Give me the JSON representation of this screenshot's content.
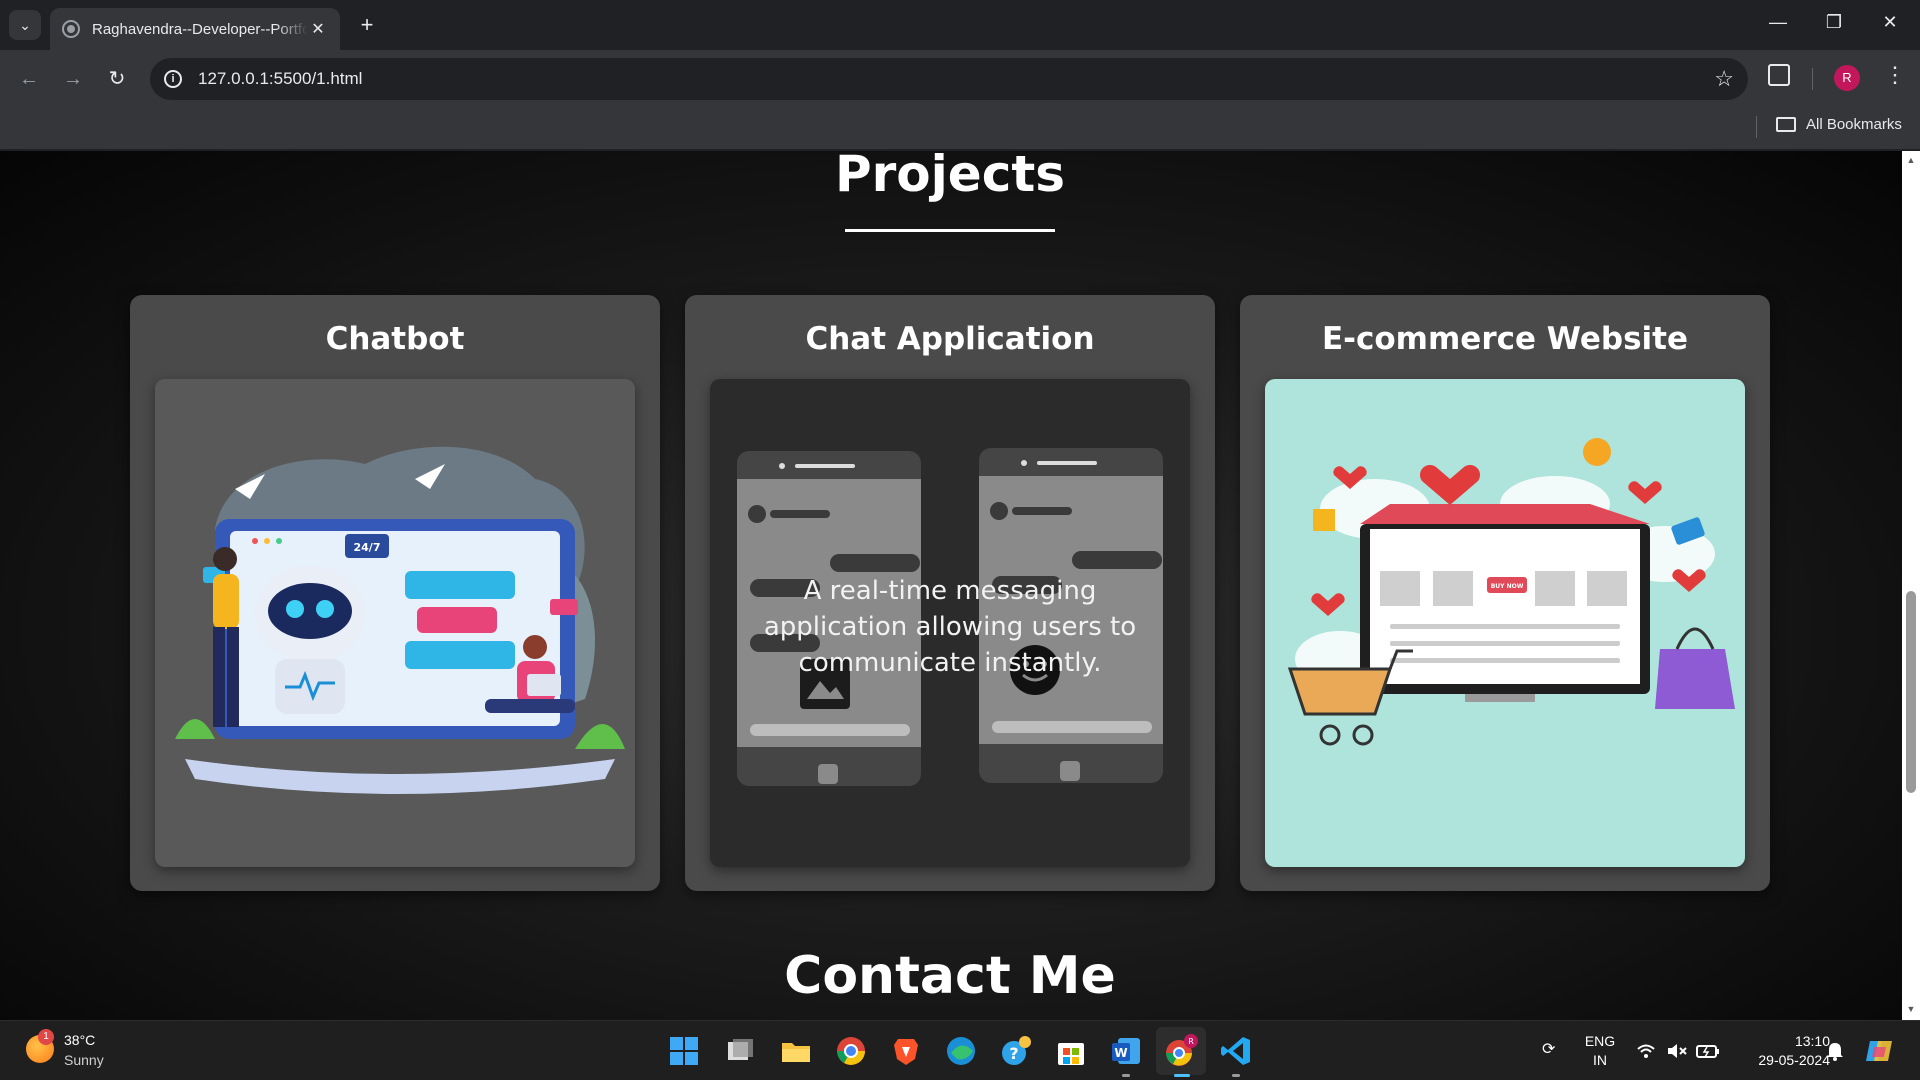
{
  "browser": {
    "tab_title": "Raghavendra--Developer--Portfolio",
    "tab_close": "✕",
    "new_tab": "+",
    "url": "127.0.0.1:5500/1.html",
    "bookmarks_label": "All Bookmarks",
    "profile_initial": "R",
    "minimize": "—",
    "restore": "❐",
    "close": "✕"
  },
  "page": {
    "projects_title": "Projects",
    "contact_title": "Contact Me",
    "cards": [
      {
        "title": "Chatbot"
      },
      {
        "title": "Chat Application",
        "description": "A real-time messaging application allowing users to communicate instantly."
      },
      {
        "title": "E-commerce Website"
      }
    ],
    "illustrations": {
      "chatbot_badge": "24/7",
      "ecommerce_button": "BUY NOW"
    }
  },
  "taskbar": {
    "weather_temp": "38°C",
    "weather_condition": "Sunny",
    "weather_badge": "1",
    "lang_top": "ENG",
    "lang_bottom": "IN",
    "time": "13:10",
    "date": "29-05-2024",
    "chrome_badge": "R"
  },
  "colors": {
    "card_bg": "#4a4a4a",
    "ecommerce_bg": "#aee4dc",
    "accent_pink": "#e91e63",
    "accent_blue": "#1976d2"
  }
}
